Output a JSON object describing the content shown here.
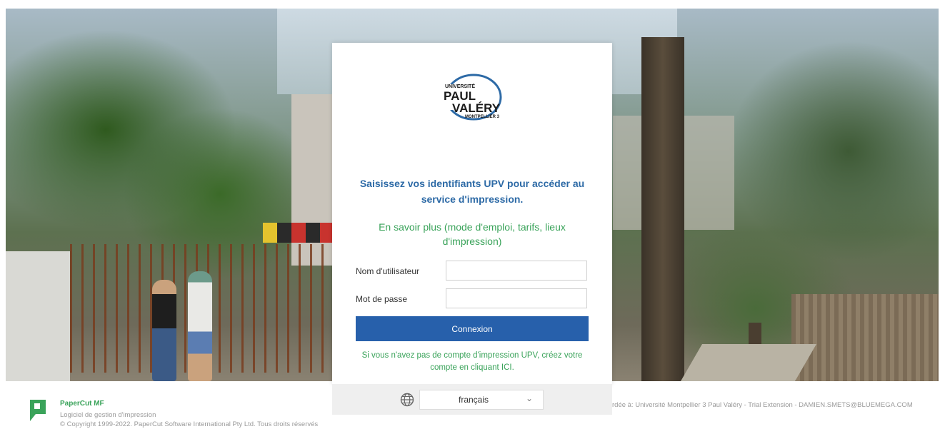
{
  "login": {
    "intro_text": "Saisissez vos identifiants UPV pour accéder au service d'impression.",
    "more_link": "En savoir plus (mode d'emploi, tarifs, lieux d'impression)",
    "username_label": "Nom d'utilisateur",
    "username_value": "",
    "password_label": "Mot de passe",
    "password_value": "",
    "submit_label": "Connexion",
    "signup_link": "Si vous n'avez pas de compte d'impression UPV, créez votre compte en cliquant ICI."
  },
  "logo": {
    "line1": "UNIVERSITÉ",
    "line2": "PAUL",
    "line3": "VALÉRY",
    "line4": "MONTPELLIER 3",
    "ring_color": "#2d6aa6"
  },
  "language": {
    "selected": "français",
    "icon": "globe-icon"
  },
  "footer": {
    "product": "PaperCut MF",
    "tagline": "Logiciel de gestion d'impression",
    "copyright": "© Copyright 1999-2022. PaperCut Software International Pty Ltd. Tous droits réservés",
    "license": "rdée à: Université Montpellier 3 Paul Valéry - Trial Extension - DAMIEN.SMETS@BLUEMEGA.COM",
    "brand_color": "#3aa35a"
  },
  "colors": {
    "primary_button": "#2760ab",
    "intro_text": "#2d6aa6",
    "link_green": "#3aa35a"
  }
}
